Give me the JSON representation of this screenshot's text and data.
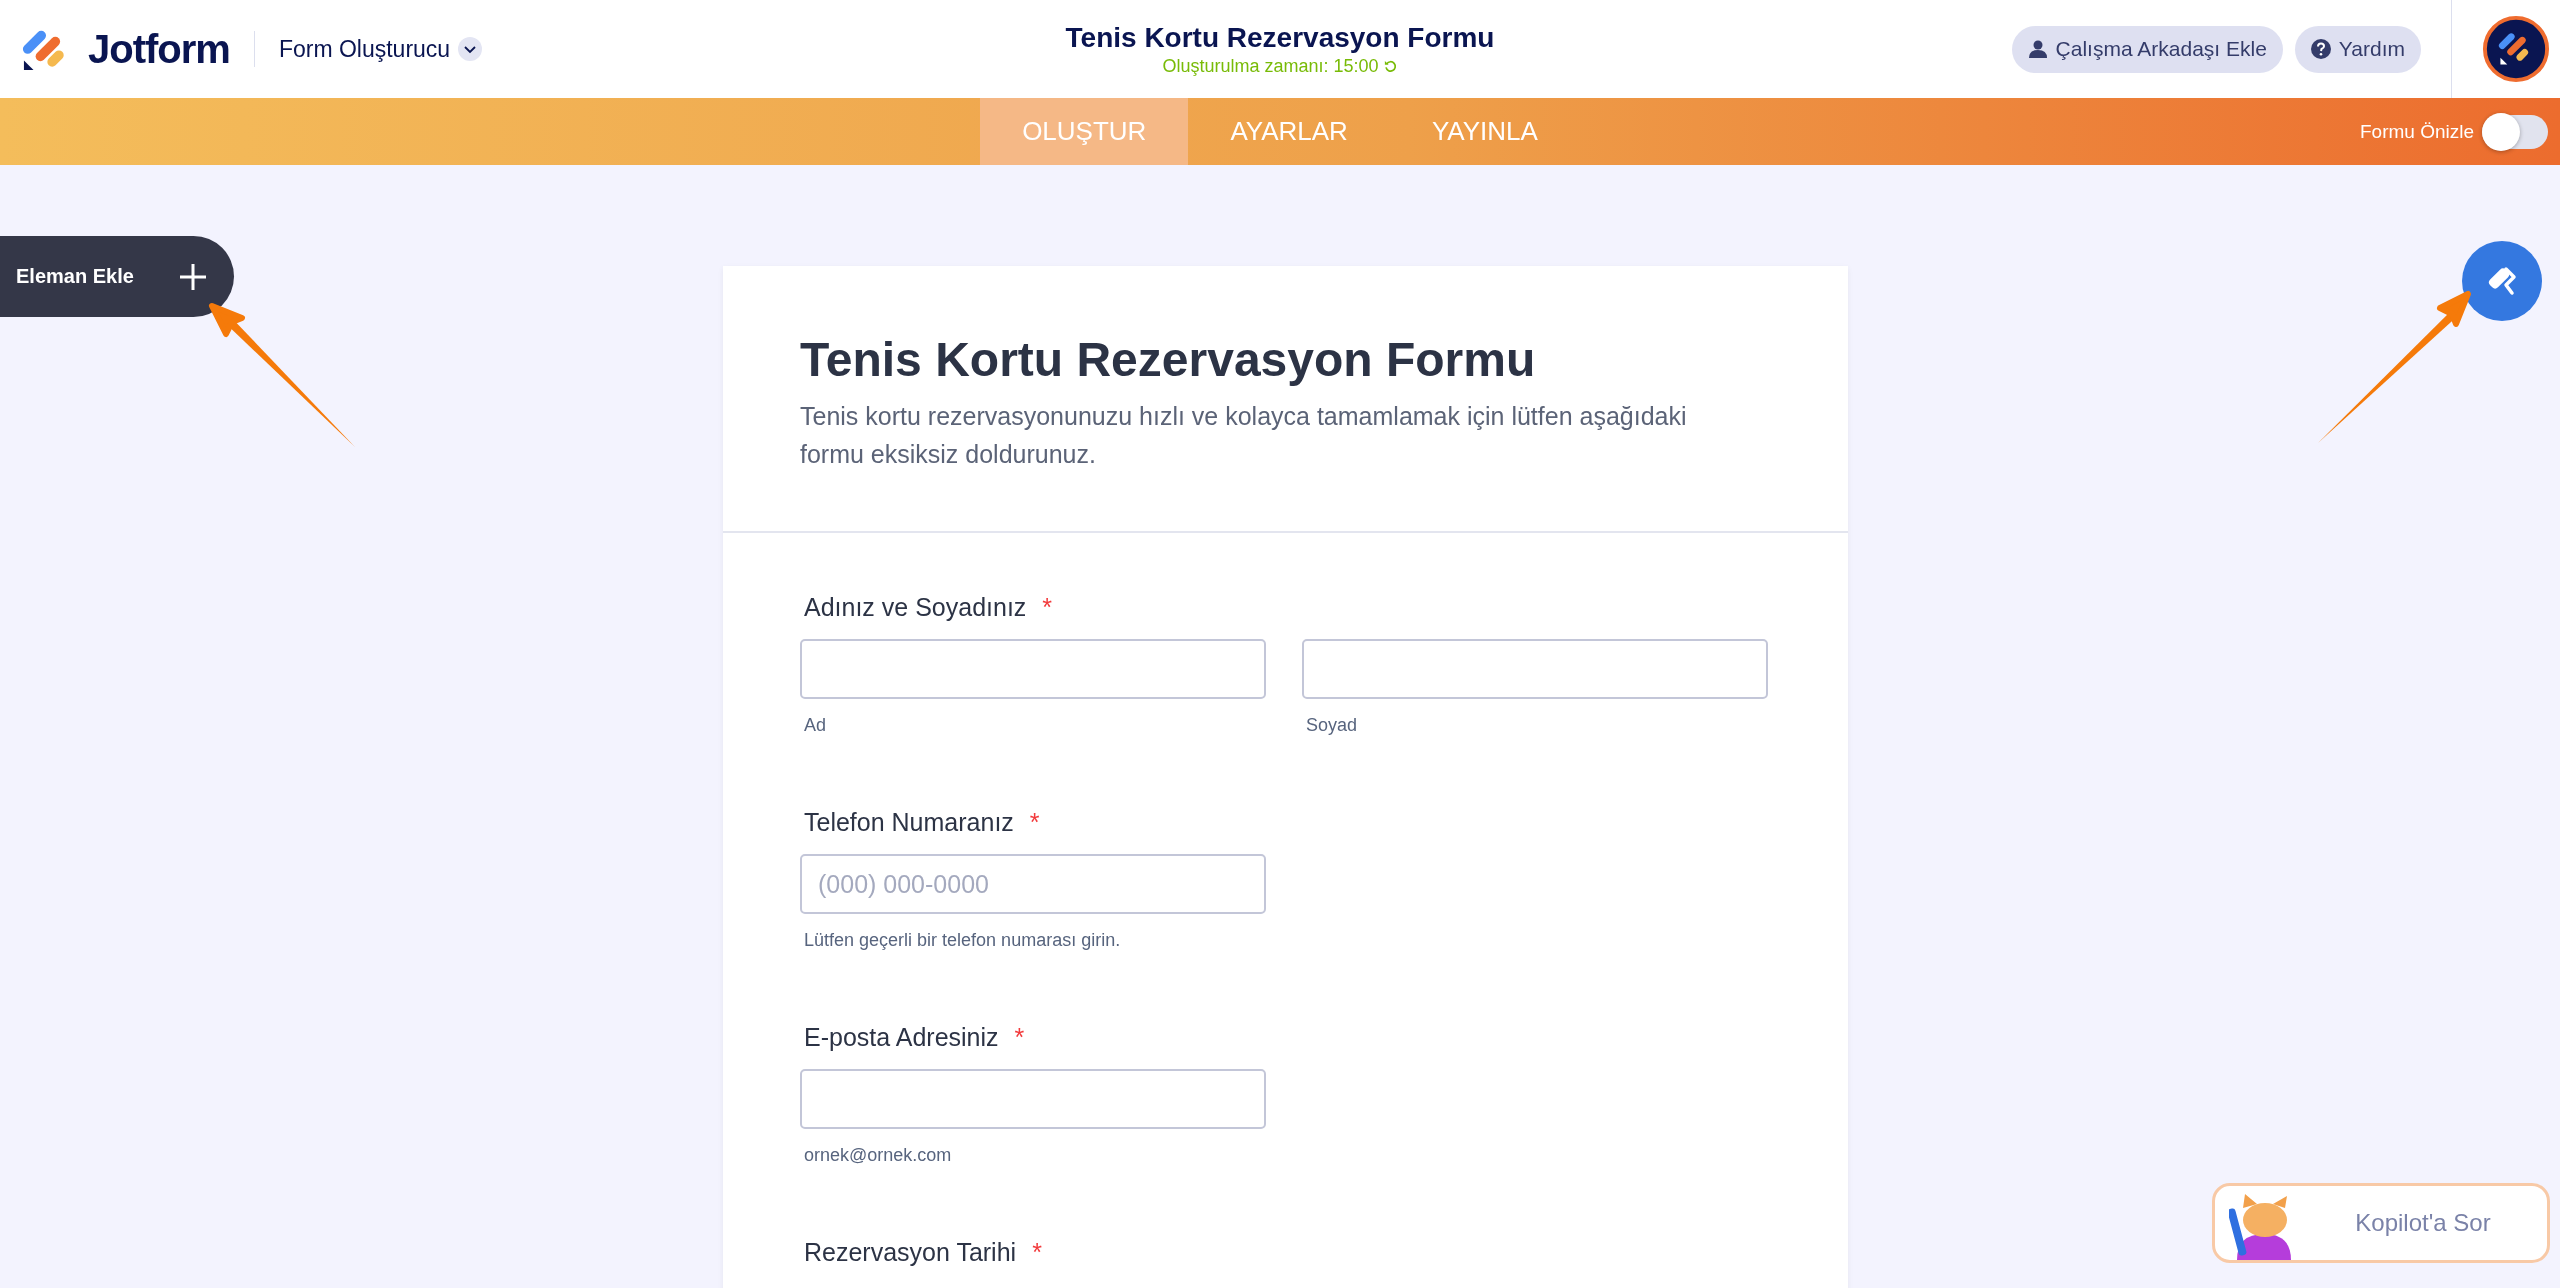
{
  "header": {
    "logo_text": "Jotform",
    "product": "Form Oluşturucu",
    "title": "Tenis Kortu Rezervasyon Formu",
    "subtitle": "Oluşturulma zamanı: 15:00",
    "buttons": [
      {
        "kind": "person",
        "label": "Çalışma Arkadaşı Ekle"
      },
      {
        "kind": "help",
        "label": "Yardım"
      }
    ]
  },
  "tabs": [
    {
      "label": "OLUŞTUR",
      "selected": true
    },
    {
      "label": "AYARLAR",
      "selected": false
    },
    {
      "label": "YAYINLA",
      "selected": false
    }
  ],
  "preview": {
    "label": "Formu Önizle",
    "on": false
  },
  "add_element": "Eleman Ekle",
  "form": {
    "title": "Tenis Kortu Rezervasyon Formu",
    "description": "Tenis kortu rezervasyonunuzu hızlı ve kolayca tamamlamak için lütfen aşağıdaki formu eksiksiz doldurunuz.",
    "fields": [
      {
        "label": "Adınız ve Soyadınız",
        "required_mark": "*",
        "inputs": [
          {
            "sublabel": "Ad"
          },
          {
            "sublabel": "Soyad"
          }
        ]
      },
      {
        "label": "Telefon Numaranız",
        "required_mark": "*",
        "inputs": [
          {
            "placeholder": "(000) 000-0000",
            "sublabel": "Lütfen geçerli bir telefon numarası girin."
          }
        ]
      },
      {
        "label": "E-posta Adresiniz",
        "required_mark": "*",
        "inputs": [
          {
            "sublabel": "ornek@ornek.com"
          }
        ]
      },
      {
        "label": "Rezervasyon Tarihi",
        "required_mark": "*"
      }
    ]
  },
  "copilot": "Kopilot'a Sor"
}
